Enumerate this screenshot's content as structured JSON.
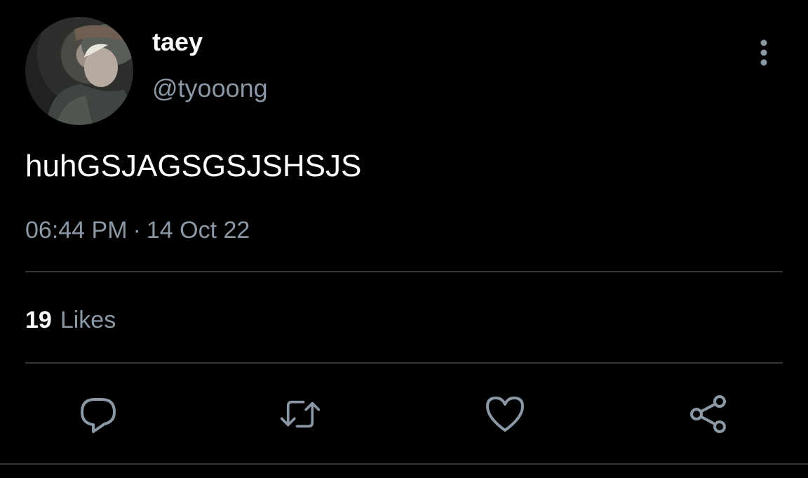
{
  "user": {
    "display_name": "taey",
    "handle": "@tyooong"
  },
  "tweet": {
    "text": "huhGSJAGSGSJSHSJS",
    "time": "06:44 PM",
    "separator": "·",
    "date": "14 Oct 22"
  },
  "stats": {
    "likes_count": "19",
    "likes_label": "Likes"
  },
  "colors": {
    "background": "#000000",
    "primary_text": "#ffffff",
    "secondary_text": "#8b98a5",
    "divider": "#2f3336",
    "icon": "#8b98a5"
  },
  "icons": {
    "more": "more-vertical-icon",
    "reply": "reply-icon",
    "retweet": "retweet-icon",
    "like": "heart-icon",
    "share": "share-icon"
  }
}
